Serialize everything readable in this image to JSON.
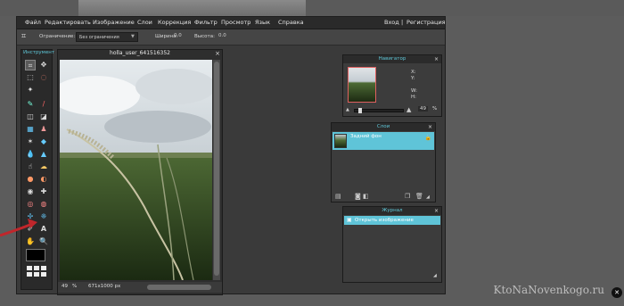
{
  "menubar": {
    "items": [
      "Файл",
      "Редактировать",
      "Изображение",
      "Слои",
      "Коррекция",
      "Фильтр",
      "Просмотр",
      "Язык",
      "Справка"
    ],
    "login": "Вход",
    "separator": "|",
    "register": "Регистрация"
  },
  "options": {
    "constraint_label": "Ограничение:",
    "constraint_value": "Без ограничения",
    "width_label": "Ширина:",
    "width_value": "0.0",
    "height_label": "Высота:",
    "height_value": "0.0"
  },
  "tools": {
    "title": "Инструмент"
  },
  "document": {
    "title": "holla_user_641516352",
    "close": "×",
    "zoom": "49",
    "zoom_unit": "%",
    "dimensions": "671x1000 px"
  },
  "navigator": {
    "title": "Навигатор",
    "close": "×",
    "x_label": "X:",
    "y_label": "Y:",
    "w_label": "W:",
    "h_label": "H:",
    "zoom_value": "49",
    "zoom_unit": "%"
  },
  "layers": {
    "title": "Слои",
    "close": "×",
    "items": [
      {
        "name": "Задний фон"
      }
    ]
  },
  "history": {
    "title": "Журнал",
    "close": "×",
    "items": [
      {
        "name": "Открыть изображение"
      }
    ]
  },
  "watermark": "KtoNaNovenkogo.ru",
  "colors": {
    "accent": "#5fc4d8",
    "panel": "#3c3c3c",
    "menubar": "#2a2a2a",
    "background": "#5c5c5c",
    "arrow": "#c0262b"
  }
}
